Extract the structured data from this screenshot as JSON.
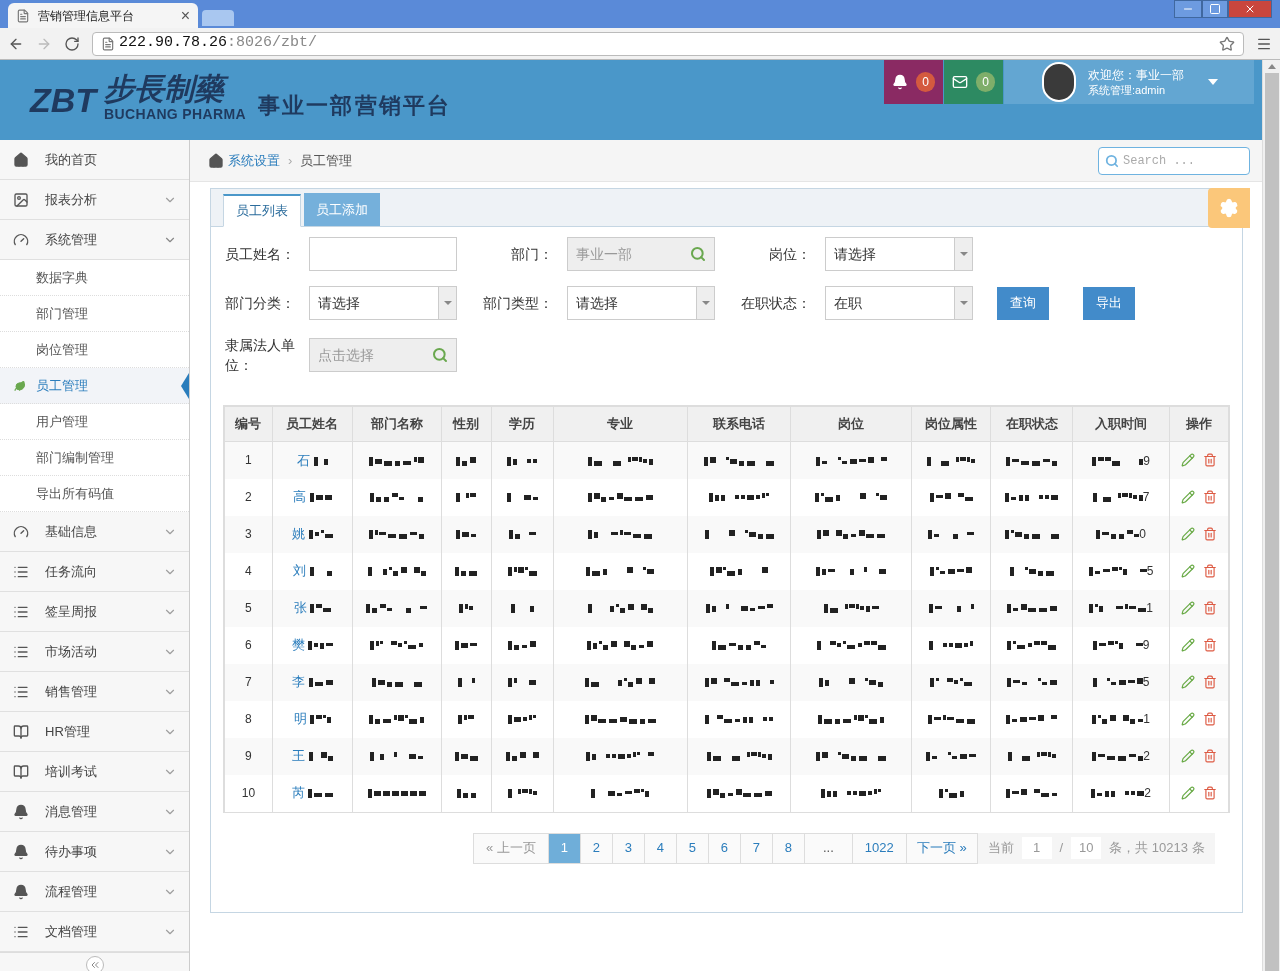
{
  "browser": {
    "tab_title": "营销管理信息平台",
    "tab_close": "×",
    "url_host": "222.90.78.26",
    "url_rest": ":8026/zbt/"
  },
  "header": {
    "logo_mark": "ZBT",
    "brand_cn": "步長制藥",
    "brand_en": "BUCHANG PHARMA",
    "platform": "事业一部营销平台",
    "notifications": "0",
    "messages": "0",
    "welcome": "欢迎您：事业一部",
    "role": "系统管理:admin"
  },
  "sidebar": {
    "items": [
      {
        "label": "我的首页",
        "kind": "home",
        "expandable": false
      },
      {
        "label": "报表分析",
        "kind": "image",
        "expandable": true
      },
      {
        "label": "系统管理",
        "kind": "dashboard",
        "expandable": true,
        "expanded": true,
        "children": [
          {
            "label": "数据字典",
            "selected": false
          },
          {
            "label": "部门管理",
            "selected": false
          },
          {
            "label": "岗位管理",
            "selected": false
          },
          {
            "label": "员工管理",
            "selected": true
          },
          {
            "label": "用户管理",
            "selected": false
          },
          {
            "label": "部门编制管理",
            "selected": false
          },
          {
            "label": "导出所有码值",
            "selected": false
          }
        ]
      },
      {
        "label": "基础信息",
        "kind": "dashboard",
        "expandable": true
      },
      {
        "label": "任务流向",
        "kind": "list",
        "expandable": true
      },
      {
        "label": "签呈周报",
        "kind": "list",
        "expandable": true
      },
      {
        "label": "市场活动",
        "kind": "list",
        "expandable": true
      },
      {
        "label": "销售管理",
        "kind": "list",
        "expandable": true
      },
      {
        "label": "HR管理",
        "kind": "book",
        "expandable": true
      },
      {
        "label": "培训考试",
        "kind": "book",
        "expandable": true
      },
      {
        "label": "消息管理",
        "kind": "bell",
        "expandable": true
      },
      {
        "label": "待办事项",
        "kind": "bell",
        "expandable": true
      },
      {
        "label": "流程管理",
        "kind": "bell",
        "expandable": true
      },
      {
        "label": "文档管理",
        "kind": "list",
        "expandable": true
      }
    ]
  },
  "breadcrumb": [
    "系统设置",
    "员工管理"
  ],
  "breadcrumb_separator": "›",
  "search": {
    "placeholder": "Search ..."
  },
  "tabs": [
    {
      "label": "员工列表",
      "selected": true
    },
    {
      "label": "员工添加",
      "selected": false
    }
  ],
  "filters": [
    [
      {
        "label": "员工姓名：",
        "kind": "text"
      },
      {
        "label": "部门：",
        "kind": "lookup",
        "placeholder": "事业一部"
      },
      {
        "label": "岗位：",
        "kind": "select",
        "value": "请选择"
      }
    ],
    [
      {
        "label": "部门分类：",
        "kind": "select",
        "value": "请选择"
      },
      {
        "label": "部门类型：",
        "kind": "select",
        "value": "请选择"
      },
      {
        "label": "在职状态：",
        "kind": "select",
        "value": "在职"
      }
    ],
    [
      {
        "label": "隶属法人单位：",
        "kind": "lookup",
        "placeholder": "点击选择"
      }
    ]
  ],
  "buttons": [
    "查询",
    "导出"
  ],
  "table": {
    "columns": [
      "编号",
      "员工姓名",
      "部门名称",
      "性别",
      "学历",
      "专业",
      "联系电话",
      "岗位",
      "岗位属性",
      "在职状态",
      "入职时间",
      "操作"
    ],
    "rows": [
      {
        "number": "1",
        "name": "石",
        "date_end": "9"
      },
      {
        "number": "2",
        "name": "高",
        "date_end": "7"
      },
      {
        "number": "3",
        "name": "姚",
        "date_end": "0"
      },
      {
        "number": "4",
        "name": "刘",
        "date_end": "5"
      },
      {
        "number": "5",
        "name": "张",
        "date_end": "1"
      },
      {
        "number": "6",
        "name": "樊",
        "date_end": "9"
      },
      {
        "number": "7",
        "name": "李",
        "date_end": "5"
      },
      {
        "number": "8",
        "name": "明",
        "date_end": "1"
      },
      {
        "number": "9",
        "name": "王",
        "date_end": "2"
      },
      {
        "number": "10",
        "name": "芮",
        "date_end": "2"
      }
    ]
  },
  "pagination": {
    "prev": "« 上一页",
    "pages": [
      {
        "label": "1",
        "selected": true
      },
      {
        "label": "2",
        "selected": false
      },
      {
        "label": "3",
        "selected": false
      },
      {
        "label": "4",
        "selected": false
      },
      {
        "label": "5",
        "selected": false
      },
      {
        "label": "6",
        "selected": false
      },
      {
        "label": "7",
        "selected": false
      },
      {
        "label": "8",
        "selected": false
      }
    ],
    "ellipsis": "...",
    "last": "1022",
    "next": "下一页 »",
    "current_label": "当前",
    "current": "1",
    "separator": "/",
    "page_size": "10",
    "total": "条，共 10213 条"
  }
}
